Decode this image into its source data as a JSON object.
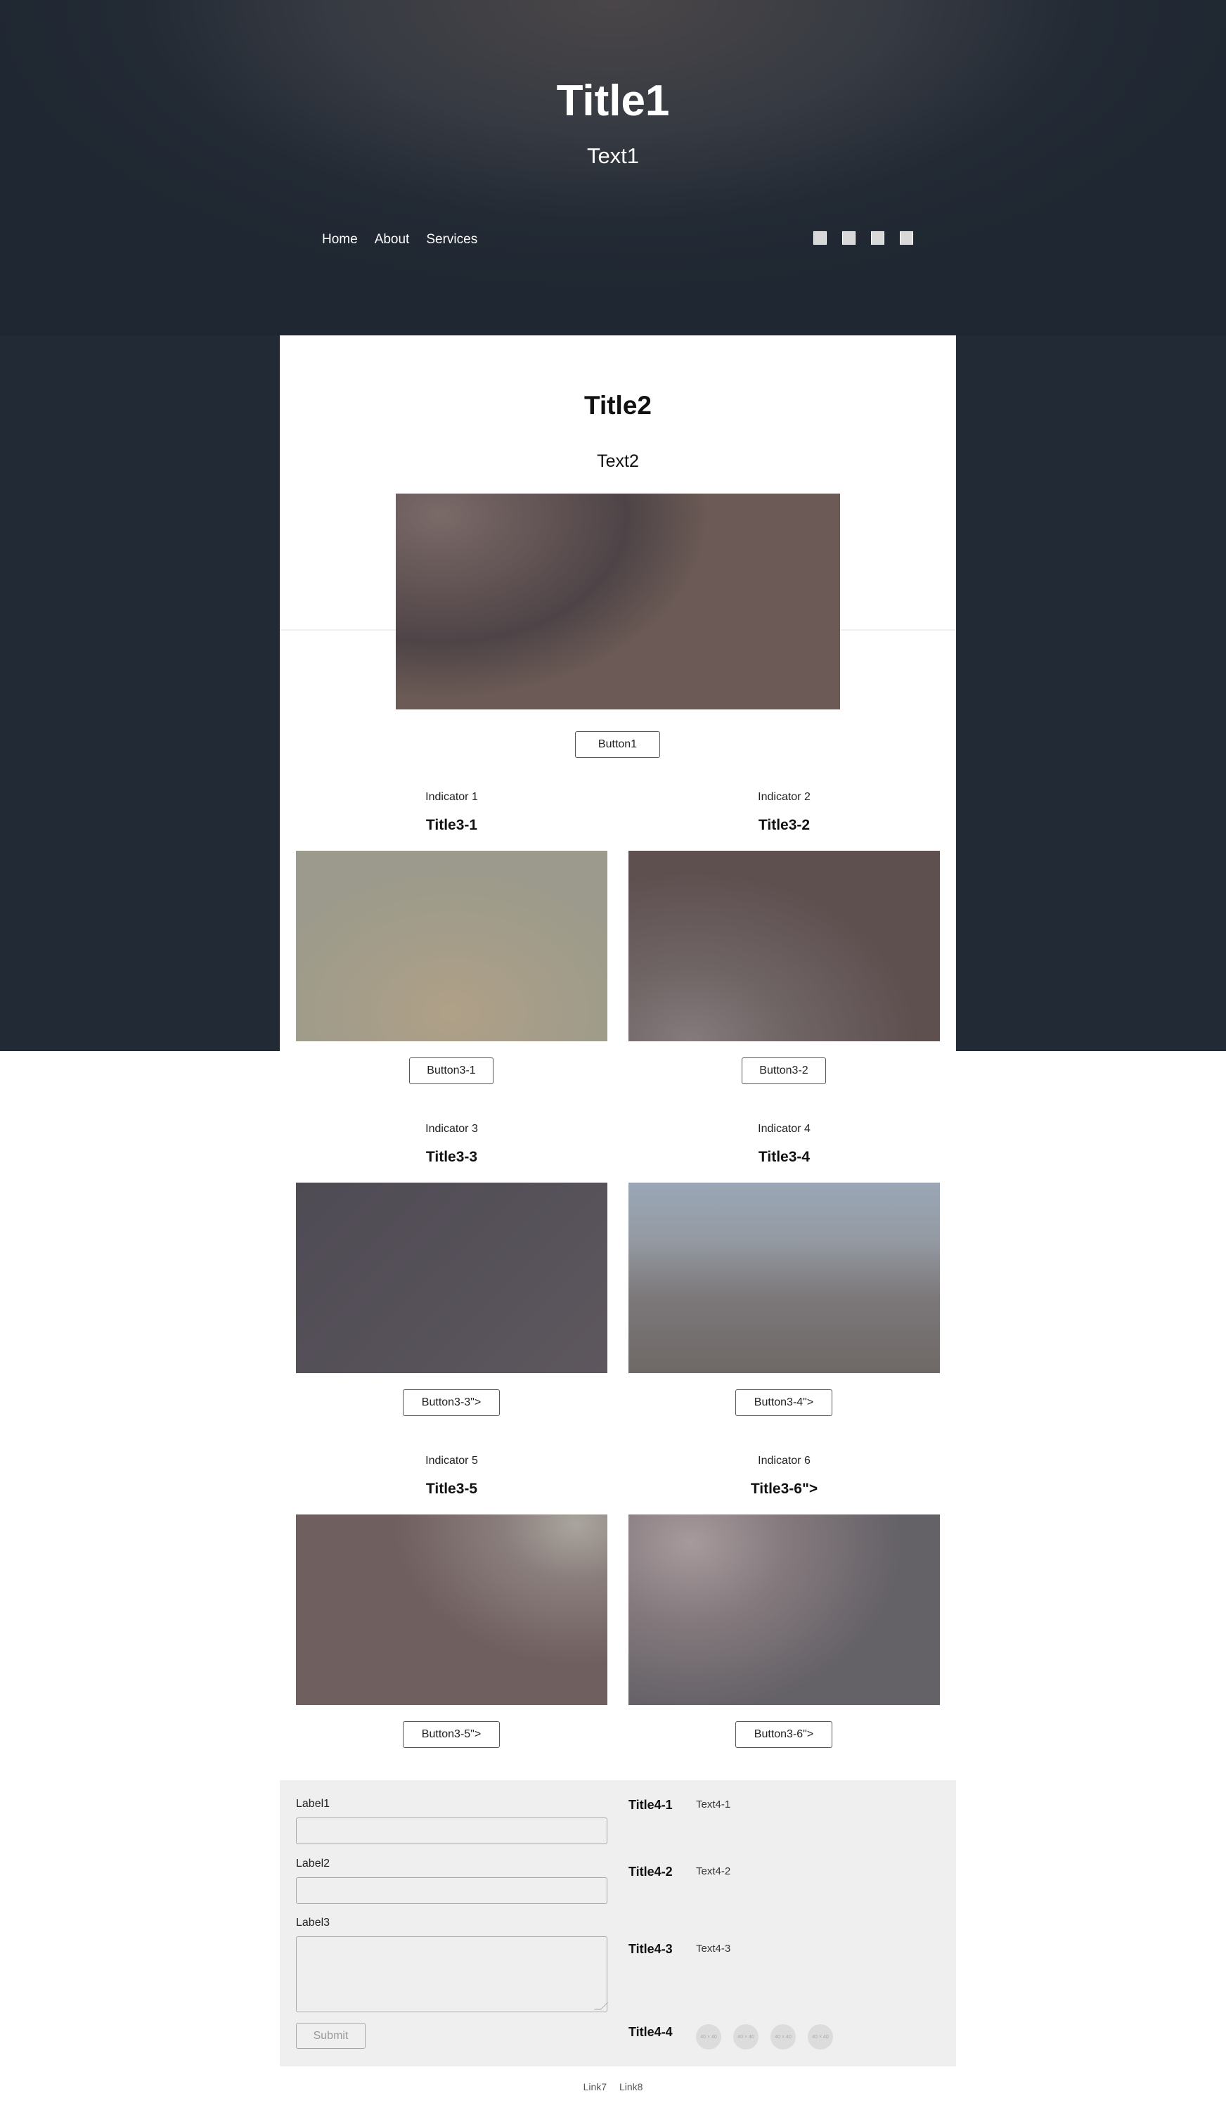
{
  "hero": {
    "title": "Title1",
    "text": "Text1",
    "nav": [
      "Home",
      "About",
      "Services"
    ]
  },
  "main": {
    "title": "Title2",
    "text": "Text2",
    "button": "Button1"
  },
  "cards": [
    {
      "indicator": "Indicator 1",
      "title": "Title3-1",
      "button": "Button3-1"
    },
    {
      "indicator": "Indicator 2",
      "title": "Title3-2",
      "button": "Button3-2"
    },
    {
      "indicator": "Indicator 3",
      "title": "Title3-3",
      "button": "Button3-3\">"
    },
    {
      "indicator": "Indicator 4",
      "title": "Title3-4",
      "button": "Button3-4\">"
    },
    {
      "indicator": "Indicator 5",
      "title": "Title3-5",
      "button": "Button3-5\">"
    },
    {
      "indicator": "Indicator 6",
      "title": "Title3-6\">",
      "button": "Button3-6\">"
    }
  ],
  "form": {
    "label1": "Label1",
    "label2": "Label2",
    "label3": "Label3",
    "submit": "Submit"
  },
  "info": [
    {
      "title": "Title4-1",
      "text": "Text4-1"
    },
    {
      "title": "Title4-2",
      "text": "Text4-2"
    },
    {
      "title": "Title4-3",
      "text": "Text4-3"
    },
    {
      "title": "Title4-4"
    }
  ],
  "badges": [
    "40 × 40",
    "40 × 40",
    "40 × 40",
    "40 × 40"
  ],
  "footer": {
    "link7": "Link7",
    "link8": "Link8"
  },
  "social_icons": [
    "social-icon-1",
    "social-icon-2",
    "social-icon-3",
    "social-icon-4"
  ]
}
